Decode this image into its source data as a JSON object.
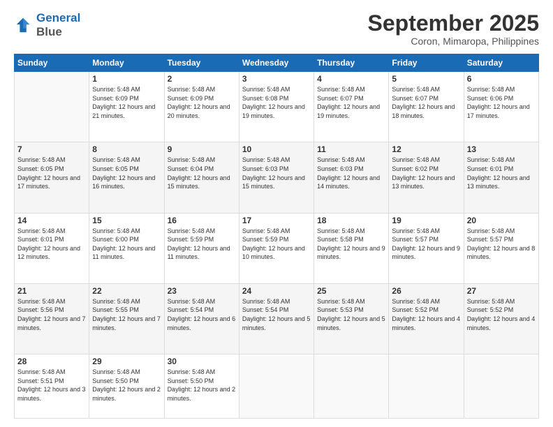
{
  "logo": {
    "line1": "General",
    "line2": "Blue"
  },
  "title": "September 2025",
  "subtitle": "Coron, Mimaropa, Philippines",
  "days_of_week": [
    "Sunday",
    "Monday",
    "Tuesday",
    "Wednesday",
    "Thursday",
    "Friday",
    "Saturday"
  ],
  "weeks": [
    [
      {
        "day": "",
        "sunrise": "",
        "sunset": "",
        "daylight": ""
      },
      {
        "day": "1",
        "sunrise": "Sunrise: 5:48 AM",
        "sunset": "Sunset: 6:09 PM",
        "daylight": "Daylight: 12 hours and 21 minutes."
      },
      {
        "day": "2",
        "sunrise": "Sunrise: 5:48 AM",
        "sunset": "Sunset: 6:09 PM",
        "daylight": "Daylight: 12 hours and 20 minutes."
      },
      {
        "day": "3",
        "sunrise": "Sunrise: 5:48 AM",
        "sunset": "Sunset: 6:08 PM",
        "daylight": "Daylight: 12 hours and 19 minutes."
      },
      {
        "day": "4",
        "sunrise": "Sunrise: 5:48 AM",
        "sunset": "Sunset: 6:07 PM",
        "daylight": "Daylight: 12 hours and 19 minutes."
      },
      {
        "day": "5",
        "sunrise": "Sunrise: 5:48 AM",
        "sunset": "Sunset: 6:07 PM",
        "daylight": "Daylight: 12 hours and 18 minutes."
      },
      {
        "day": "6",
        "sunrise": "Sunrise: 5:48 AM",
        "sunset": "Sunset: 6:06 PM",
        "daylight": "Daylight: 12 hours and 17 minutes."
      }
    ],
    [
      {
        "day": "7",
        "sunrise": "Sunrise: 5:48 AM",
        "sunset": "Sunset: 6:05 PM",
        "daylight": "Daylight: 12 hours and 17 minutes."
      },
      {
        "day": "8",
        "sunrise": "Sunrise: 5:48 AM",
        "sunset": "Sunset: 6:05 PM",
        "daylight": "Daylight: 12 hours and 16 minutes."
      },
      {
        "day": "9",
        "sunrise": "Sunrise: 5:48 AM",
        "sunset": "Sunset: 6:04 PM",
        "daylight": "Daylight: 12 hours and 15 minutes."
      },
      {
        "day": "10",
        "sunrise": "Sunrise: 5:48 AM",
        "sunset": "Sunset: 6:03 PM",
        "daylight": "Daylight: 12 hours and 15 minutes."
      },
      {
        "day": "11",
        "sunrise": "Sunrise: 5:48 AM",
        "sunset": "Sunset: 6:03 PM",
        "daylight": "Daylight: 12 hours and 14 minutes."
      },
      {
        "day": "12",
        "sunrise": "Sunrise: 5:48 AM",
        "sunset": "Sunset: 6:02 PM",
        "daylight": "Daylight: 12 hours and 13 minutes."
      },
      {
        "day": "13",
        "sunrise": "Sunrise: 5:48 AM",
        "sunset": "Sunset: 6:01 PM",
        "daylight": "Daylight: 12 hours and 13 minutes."
      }
    ],
    [
      {
        "day": "14",
        "sunrise": "Sunrise: 5:48 AM",
        "sunset": "Sunset: 6:01 PM",
        "daylight": "Daylight: 12 hours and 12 minutes."
      },
      {
        "day": "15",
        "sunrise": "Sunrise: 5:48 AM",
        "sunset": "Sunset: 6:00 PM",
        "daylight": "Daylight: 12 hours and 11 minutes."
      },
      {
        "day": "16",
        "sunrise": "Sunrise: 5:48 AM",
        "sunset": "Sunset: 5:59 PM",
        "daylight": "Daylight: 12 hours and 11 minutes."
      },
      {
        "day": "17",
        "sunrise": "Sunrise: 5:48 AM",
        "sunset": "Sunset: 5:59 PM",
        "daylight": "Daylight: 12 hours and 10 minutes."
      },
      {
        "day": "18",
        "sunrise": "Sunrise: 5:48 AM",
        "sunset": "Sunset: 5:58 PM",
        "daylight": "Daylight: 12 hours and 9 minutes."
      },
      {
        "day": "19",
        "sunrise": "Sunrise: 5:48 AM",
        "sunset": "Sunset: 5:57 PM",
        "daylight": "Daylight: 12 hours and 9 minutes."
      },
      {
        "day": "20",
        "sunrise": "Sunrise: 5:48 AM",
        "sunset": "Sunset: 5:57 PM",
        "daylight": "Daylight: 12 hours and 8 minutes."
      }
    ],
    [
      {
        "day": "21",
        "sunrise": "Sunrise: 5:48 AM",
        "sunset": "Sunset: 5:56 PM",
        "daylight": "Daylight: 12 hours and 7 minutes."
      },
      {
        "day": "22",
        "sunrise": "Sunrise: 5:48 AM",
        "sunset": "Sunset: 5:55 PM",
        "daylight": "Daylight: 12 hours and 7 minutes."
      },
      {
        "day": "23",
        "sunrise": "Sunrise: 5:48 AM",
        "sunset": "Sunset: 5:54 PM",
        "daylight": "Daylight: 12 hours and 6 minutes."
      },
      {
        "day": "24",
        "sunrise": "Sunrise: 5:48 AM",
        "sunset": "Sunset: 5:54 PM",
        "daylight": "Daylight: 12 hours and 5 minutes."
      },
      {
        "day": "25",
        "sunrise": "Sunrise: 5:48 AM",
        "sunset": "Sunset: 5:53 PM",
        "daylight": "Daylight: 12 hours and 5 minutes."
      },
      {
        "day": "26",
        "sunrise": "Sunrise: 5:48 AM",
        "sunset": "Sunset: 5:52 PM",
        "daylight": "Daylight: 12 hours and 4 minutes."
      },
      {
        "day": "27",
        "sunrise": "Sunrise: 5:48 AM",
        "sunset": "Sunset: 5:52 PM",
        "daylight": "Daylight: 12 hours and 4 minutes."
      }
    ],
    [
      {
        "day": "28",
        "sunrise": "Sunrise: 5:48 AM",
        "sunset": "Sunset: 5:51 PM",
        "daylight": "Daylight: 12 hours and 3 minutes."
      },
      {
        "day": "29",
        "sunrise": "Sunrise: 5:48 AM",
        "sunset": "Sunset: 5:50 PM",
        "daylight": "Daylight: 12 hours and 2 minutes."
      },
      {
        "day": "30",
        "sunrise": "Sunrise: 5:48 AM",
        "sunset": "Sunset: 5:50 PM",
        "daylight": "Daylight: 12 hours and 2 minutes."
      },
      {
        "day": "",
        "sunrise": "",
        "sunset": "",
        "daylight": ""
      },
      {
        "day": "",
        "sunrise": "",
        "sunset": "",
        "daylight": ""
      },
      {
        "day": "",
        "sunrise": "",
        "sunset": "",
        "daylight": ""
      },
      {
        "day": "",
        "sunrise": "",
        "sunset": "",
        "daylight": ""
      }
    ]
  ]
}
